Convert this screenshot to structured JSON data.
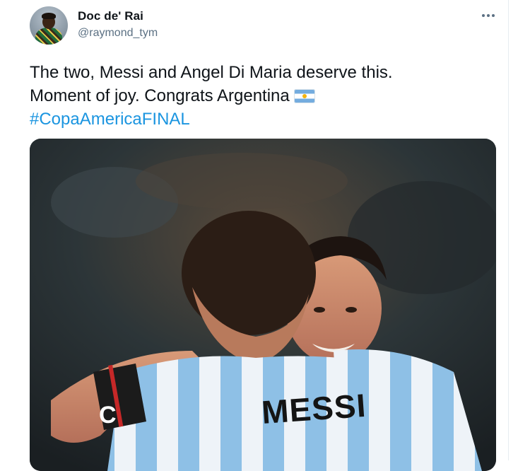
{
  "tweet": {
    "author_name": "Doc de' Rai",
    "author_handle": "@raymond_tym",
    "avatar_icon": "user-avatar",
    "more_icon": "more-options-icon",
    "text_line1": "The two, Messi and Angel Di Maria deserve this.",
    "text_line2": "Moment of joy. Congrats Argentina",
    "flag_emoji_icon": "argentina-flag-icon",
    "hashtag": "#CopaAmericaFINAL"
  },
  "media": {
    "jersey_name": "MESSI",
    "armband_letter": "C"
  },
  "colors": {
    "link": "#1b95e0",
    "secondary_text": "#5b7083",
    "primary_text": "#0f1419"
  }
}
